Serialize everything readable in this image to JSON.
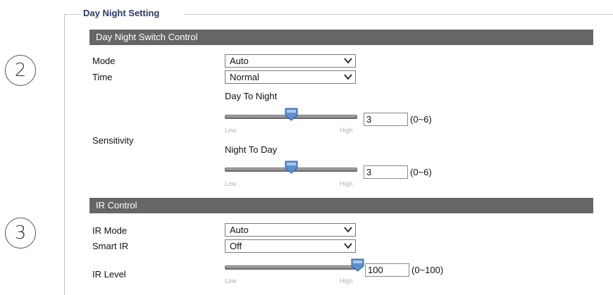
{
  "fieldset": {
    "legend": "Day Night Setting"
  },
  "annotations": {
    "circle_2": "2",
    "circle_3": "3"
  },
  "day_night": {
    "header": "Day Night Switch Control",
    "mode": {
      "label": "Mode",
      "value": "Auto"
    },
    "time": {
      "label": "Time",
      "value": "Normal"
    },
    "sensitivity": {
      "label": "Sensitivity",
      "day_to_night": {
        "label": "Day To Night",
        "value": "3",
        "range": "(0~6)",
        "low": "Low",
        "high": "High",
        "fraction": 0.5
      },
      "night_to_day": {
        "label": "Night To Day",
        "value": "3",
        "range": "(0~6)",
        "low": "Low",
        "high": "High",
        "fraction": 0.5
      }
    }
  },
  "ir": {
    "header": "IR Control",
    "mode": {
      "label": "IR Mode",
      "value": "Auto"
    },
    "smart_ir": {
      "label": "Smart IR",
      "value": "Off"
    },
    "level": {
      "label": "IR Level",
      "value": "100",
      "range": "(0~100)",
      "low": "Low",
      "high": "High",
      "fraction": 1.0
    }
  },
  "icons": {
    "dropdown": "chevron-down-icon",
    "slider_thumb": "slider-thumb-icon"
  },
  "colors": {
    "section_bar": "#666666",
    "legend": "#2a3a6a",
    "thumb": "#5b8fd0"
  }
}
